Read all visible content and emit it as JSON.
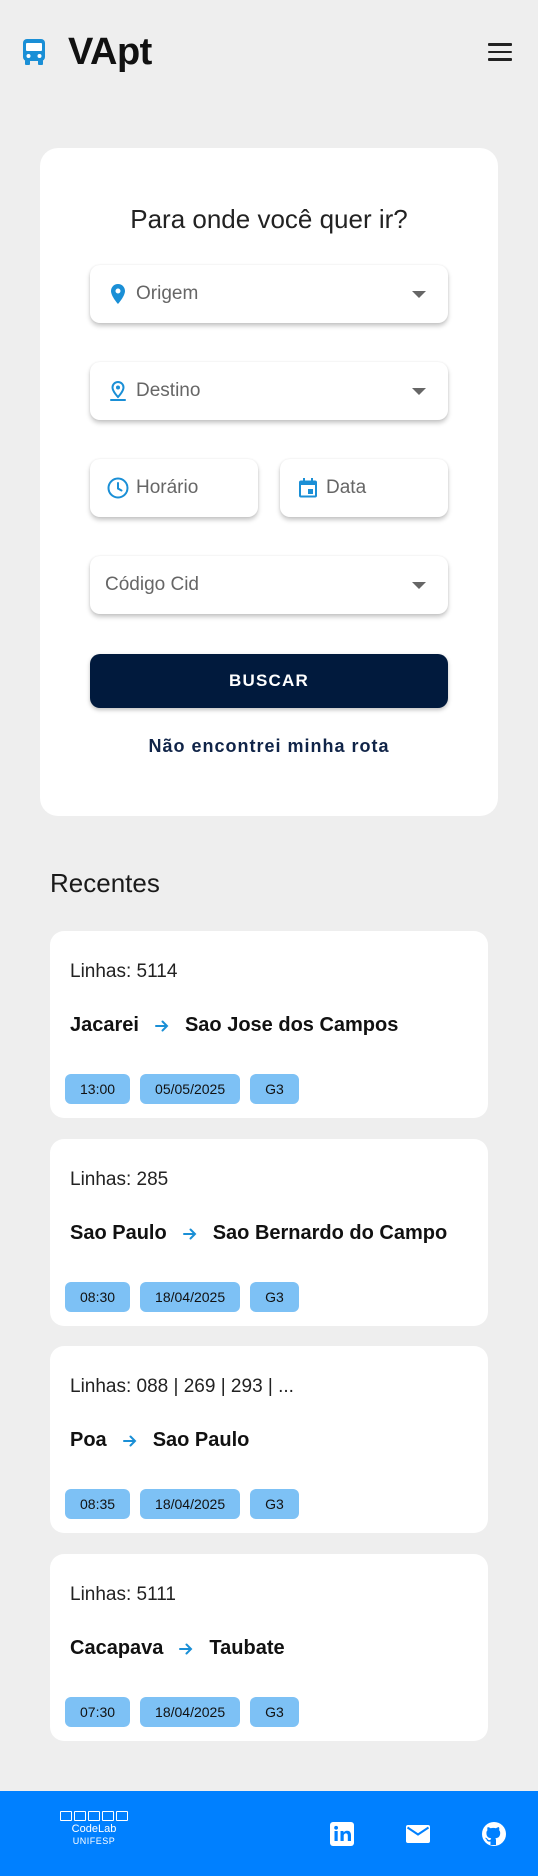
{
  "header": {
    "app_title": "VApt",
    "bus_icon": "bus-icon",
    "menu_icon": "hamburger-menu-icon"
  },
  "search": {
    "title": "Para onde você quer ir?",
    "origem_placeholder": "Origem",
    "destino_placeholder": "Destino",
    "horario_placeholder": "Horário",
    "data_placeholder": "Data",
    "codigo_placeholder": "Código Cid",
    "buscar_label": "BUSCAR",
    "no_route_label": "Não encontrei minha rota"
  },
  "recent": {
    "heading": "Recentes",
    "items": [
      {
        "lines": "Linhas: 5114",
        "from": "Jacarei",
        "to": "Sao Jose dos Campos",
        "time": "13:00",
        "date": "05/05/2025",
        "group": "G3"
      },
      {
        "lines": "Linhas: 285",
        "from": "Sao Paulo",
        "to": "Sao Bernardo do Campo",
        "time": "08:30",
        "date": "18/04/2025",
        "group": "G3"
      },
      {
        "lines": "Linhas: 088 | 269 | 293 | ...",
        "from": "Poa",
        "to": "Sao Paulo",
        "time": "08:35",
        "date": "18/04/2025",
        "group": "G3"
      },
      {
        "lines": "Linhas: 5111",
        "from": "Cacapava",
        "to": "Taubate",
        "time": "07:30",
        "date": "18/04/2025",
        "group": "G3"
      }
    ]
  },
  "footer": {
    "logo_line1": "CodeLab",
    "logo_line2": "UNIFESP",
    "social_icons": [
      "linkedin-icon",
      "mail-icon",
      "github-icon"
    ]
  },
  "colors": {
    "accent": "#1a8fd6",
    "primary_dark": "#011a3d",
    "tag_bg": "#7dc1f5",
    "footer_bg": "#0080ff",
    "page_bg": "#eeeeee"
  }
}
